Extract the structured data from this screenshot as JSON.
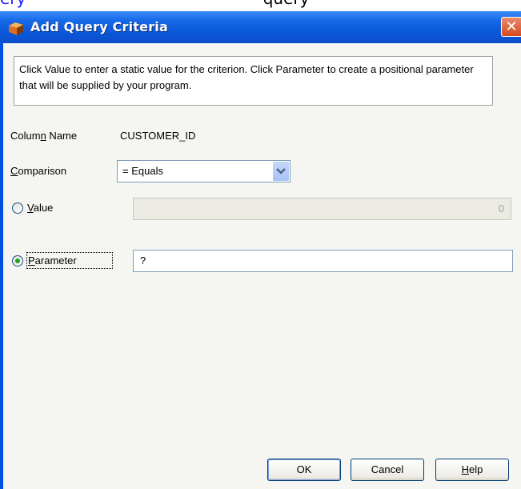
{
  "background": {
    "text_segments": [
      "ery",
      " ",
      "query"
    ]
  },
  "dialog": {
    "title": "Add Query Criteria",
    "close_label": "✕",
    "description": "Click Value to enter a static value for the criterion. Click Parameter to create a positional parameter that will be supplied by your program.",
    "column_name": {
      "label_pre": "Colum",
      "label_mnemonic": "n",
      "label_post": " Name",
      "value": "CUSTOMER_ID"
    },
    "comparison": {
      "label_mnemonic": "C",
      "label_post": "omparison",
      "selected": "= Equals"
    },
    "value_option": {
      "label_mnemonic": "V",
      "label_post": "alue",
      "selected": false,
      "field_value": "0"
    },
    "parameter_option": {
      "label_mnemonic": "P",
      "label_post": "arameter",
      "selected": true,
      "field_value": "?"
    },
    "buttons": {
      "ok": "OK",
      "cancel": "Cancel",
      "help_mnemonic": "H",
      "help_post": "elp"
    }
  },
  "colors": {
    "titlebar": "#0a56d8",
    "client": "#f5f5f2",
    "radio_dot": "#21a121",
    "close": "#d64b20"
  }
}
